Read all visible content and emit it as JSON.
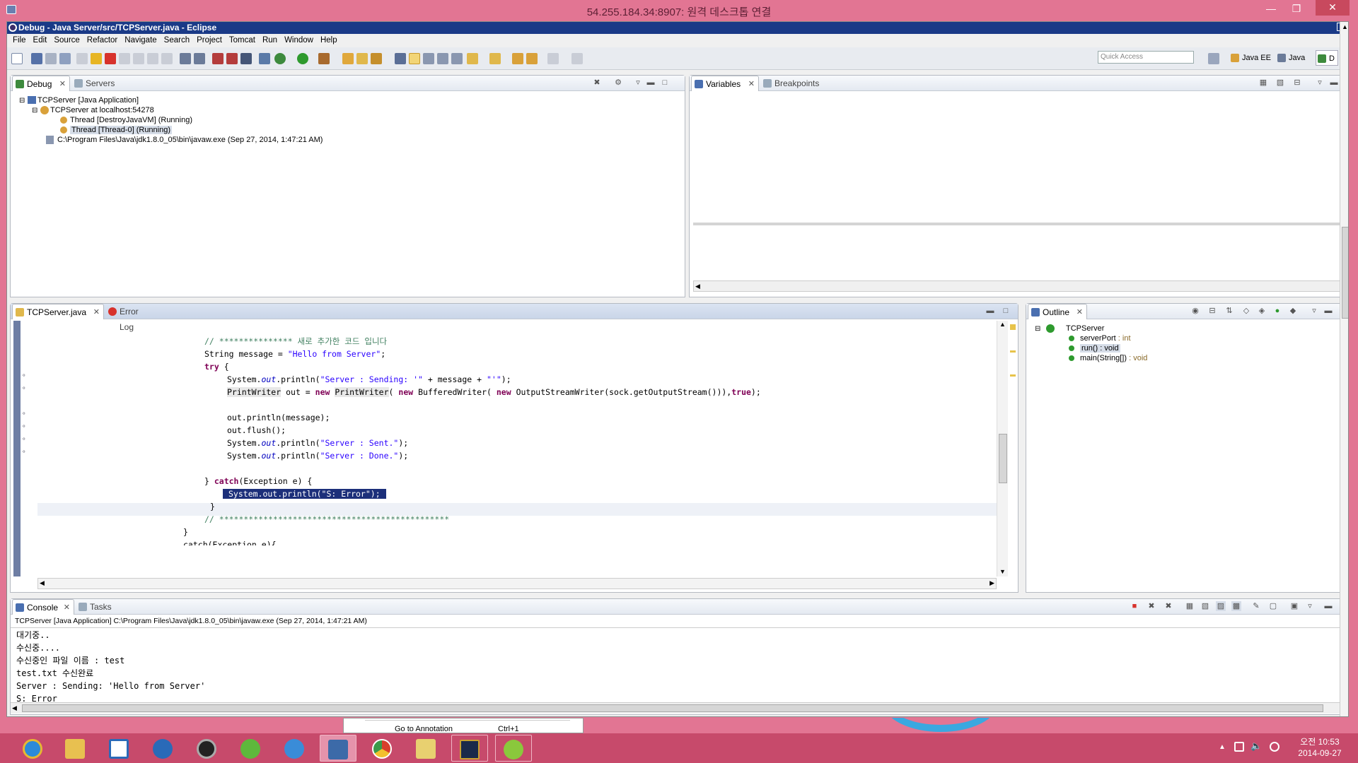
{
  "remote": {
    "title": "54.255.184.34:8907: 원격 데스크톱 연결"
  },
  "eclipse": {
    "title": "Debug - Java Server/src/TCPServer.java - Eclipse",
    "menus": [
      "File",
      "Edit",
      "Source",
      "Refactor",
      "Navigate",
      "Search",
      "Project",
      "Tomcat",
      "Run",
      "Window",
      "Help"
    ],
    "quick_access_placeholder": "Quick Access",
    "perspectives": [
      "Java EE",
      "Java",
      "D"
    ]
  },
  "debug_view": {
    "tab_label": "Debug",
    "tab2_label": "Servers",
    "tree": [
      "TCPServer [Java Application]",
      "TCPServer at localhost:54278",
      "Thread [DestroyJavaVM] (Running)",
      "Thread [Thread-0] (Running)",
      "C:\\Program Files\\Java\\jdk1.8.0_05\\bin\\javaw.exe (Sep 27, 2014, 1:47:21 AM)"
    ]
  },
  "variables_view": {
    "tab_label": "Variables",
    "tab2_label": "Breakpoints"
  },
  "editor": {
    "tab_label": "TCPServer.java",
    "tab2_label": "Error Log",
    "lines": {
      "l1": "// *************** 새로 추가한 코드 입니다",
      "l2_a": "String message = ",
      "l2_s": "\"Hello from Server\"",
      "l2_b": ";",
      "l3_kw": "try",
      "l3_b": " {",
      "l4_a": "System.",
      "l4_f": "out",
      "l4_b": ".println(",
      "l4_s1": "\"Server : Sending: '\"",
      "l4_c": " + message + ",
      "l4_s2": "\"'\"",
      "l4_d": ");",
      "l5_t1": "PrintWriter",
      "l5_a": " out = ",
      "l5_kw1": "new",
      "l5_sp": " ",
      "l5_t2": "PrintWriter",
      "l5_b": "( ",
      "l5_kw2": "new",
      "l5_c": " BufferedWriter( ",
      "l5_kw3": "new",
      "l5_d": " OutputStreamWriter(sock.getOutputStream())),",
      "l5_kw4": "true",
      "l5_e": ");",
      "l6": "out.println(message);",
      "l7": "out.flush();",
      "l8_a": "System.",
      "l8_f": "out",
      "l8_b": ".println(",
      "l8_s": "\"Server : Sent.\"",
      "l8_c": ");",
      "l9_a": "System.",
      "l9_f": "out",
      "l9_b": ".println(",
      "l9_s": "\"Server : Done.\"",
      "l9_c": ");",
      "l10_a": "} ",
      "l10_kw": "catch",
      "l10_b": "(Exception e) {",
      "l11": "System.out.println(\"S: Error\");",
      "l12": "}",
      "l13": "// ***********************************************",
      "l14": "}",
      "l15": "catch(Exception e){"
    }
  },
  "outline_view": {
    "tab_label": "Outline",
    "items": [
      {
        "name": "TCPServer",
        "type": ""
      },
      {
        "name": "serverPort",
        "type": " : int"
      },
      {
        "name": "run()",
        "type": " : void"
      },
      {
        "name": "main(String[])",
        "type": " : void"
      }
    ]
  },
  "console_view": {
    "tab_label": "Console",
    "tab2_label": "Tasks",
    "header": "TCPServer [Java Application] C:\\Program Files\\Java\\jdk1.8.0_05\\bin\\javaw.exe (Sep 27, 2014, 1:47:21 AM)",
    "lines": [
      "대기중..",
      "수신중....",
      "수신중인 파일 이름 : test",
      "test.txt 수신완료",
      "Server : Sending: 'Hello from Server'",
      "S: Error"
    ]
  },
  "behind": {
    "menu_item": "Go to Annotation",
    "shortcut": "Ctrl+1"
  },
  "taskbar": {
    "time": "오전 10:53",
    "date": "2014-09-27",
    "apps": [
      "internet-explorer",
      "file-explorer",
      "task-app",
      "media-player-live",
      "video-app",
      "utorrent",
      "itunes",
      "remote-desktop",
      "chrome",
      "folder",
      "league",
      "brackets"
    ]
  },
  "colors": {
    "titlebar": "#1a3a87",
    "selection": "#1c2f7a",
    "remote_bar": "#e27593",
    "taskbar": "#c74a6b"
  }
}
